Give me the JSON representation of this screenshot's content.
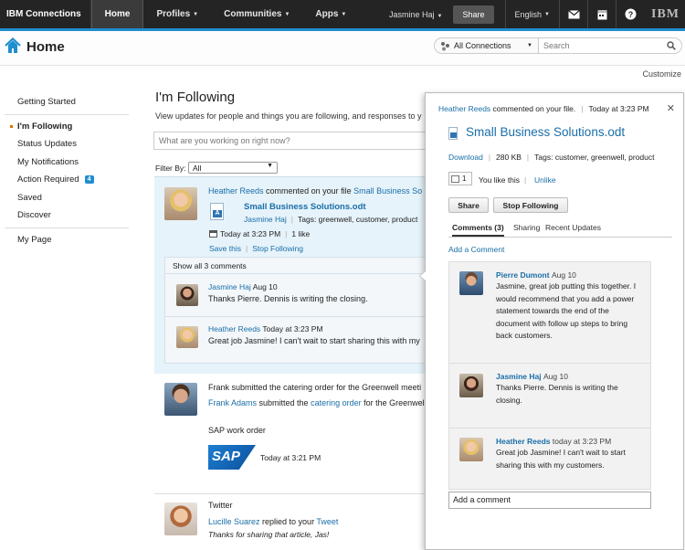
{
  "topnav": {
    "brand": "IBM Connections",
    "items": [
      {
        "label": "Home"
      },
      {
        "label": "Profiles"
      },
      {
        "label": "Communities"
      },
      {
        "label": "Apps"
      }
    ],
    "user": "Jasmine Haj",
    "share": "Share",
    "language": "English",
    "ibm_logo": "IBM"
  },
  "header": {
    "title": "Home",
    "scope": "All Connections",
    "search_placeholder": "Search",
    "customize": "Customize"
  },
  "leftnav": {
    "getting_started": "Getting Started",
    "items": [
      {
        "label": "I'm Following"
      },
      {
        "label": "Status Updates"
      },
      {
        "label": "My Notifications"
      },
      {
        "label": "Action Required",
        "badge": "4"
      },
      {
        "label": "Saved"
      },
      {
        "label": "Discover"
      }
    ],
    "my_page": "My Page"
  },
  "main": {
    "title": "I'm Following",
    "subtitle": "View updates for people and things you are following, and responses to y",
    "status_placeholder": "What are you working on right now?",
    "filter_label": "Filter By:",
    "filter_value": "All",
    "entry1": {
      "actor": "Heather Reeds",
      "action": " commented on your file ",
      "target": "Small Business So",
      "file_title": "Small Business Solutions.odt",
      "file_owner": "Jasmine Haj",
      "tags": "Tags: greenwell, customer, product",
      "time": "Today at 3:23 PM",
      "likes": "1 like",
      "save": "Save this",
      "stop": "Stop Following",
      "show_all": "Show all 3 comments",
      "comments": [
        {
          "name": "Jasmine Haj",
          "time": "Aug 10",
          "text": "Thanks Pierre. Dennis is writing the closing."
        },
        {
          "name": "Heather Reeds",
          "time": "Today at 3:23 PM",
          "text": "Great job Jasmine! I can't wait to start sharing this with my"
        }
      ]
    },
    "entry2": {
      "line1": "Frank submitted the catering order for the Greenwell meeti",
      "actor": "Frank Adams",
      "action": " submitted the ",
      "target": "catering order",
      "action2": " for the Greenwell",
      "app": "SAP work order",
      "sap_logo": "SAP",
      "time": "Today at 3:21 PM"
    },
    "entry3": {
      "source": "Twitter",
      "actor": "Lucille Suarez",
      "action": " replied to your ",
      "target": "Tweet",
      "text": "Thanks for sharing that article, Jas!"
    }
  },
  "panel": {
    "notice_actor": "Heather Reeds",
    "notice_action": " commented on your file.",
    "notice_time": "Today at 3:23 PM",
    "file_title": "Small Business Solutions.odt",
    "download": "Download",
    "size": "280 KB",
    "tags": "Tags: customer, greenwell, product",
    "like_count": "1",
    "you_like": "You like this",
    "unlike": "Unlike",
    "share_btn": "Share",
    "stop_btn": "Stop Following",
    "tabs": [
      "Comments (3)",
      "Sharing",
      "Recent Updates"
    ],
    "add_comment_link": "Add a Comment",
    "comments": [
      {
        "name": "Pierre Dumont",
        "time": "Aug 10",
        "text": "Jasmine, great job putting this together. I would recommend that you add a power statement towards the end of the document with follow up steps to bring back customers."
      },
      {
        "name": "Jasmine Haj",
        "time": "Aug 10",
        "text": "Thanks Pierre. Dennis is writing the closing."
      },
      {
        "name": "Heather Reeds",
        "time": "today at 3:23 PM",
        "text": "Great job Jasmine! I can't wait to start sharing this with my customers."
      }
    ],
    "add_comment_placeholder": "Add a comment"
  },
  "icons": [
    "home-icon",
    "search-icon",
    "mail-icon",
    "calendar-icon",
    "help-icon",
    "close-icon",
    "file-icon",
    "like-icon"
  ],
  "colors": {
    "accent": "#1f8ecf",
    "link": "#1a6ea8",
    "nav": "#242424",
    "highlight": "#e6f3fa"
  }
}
